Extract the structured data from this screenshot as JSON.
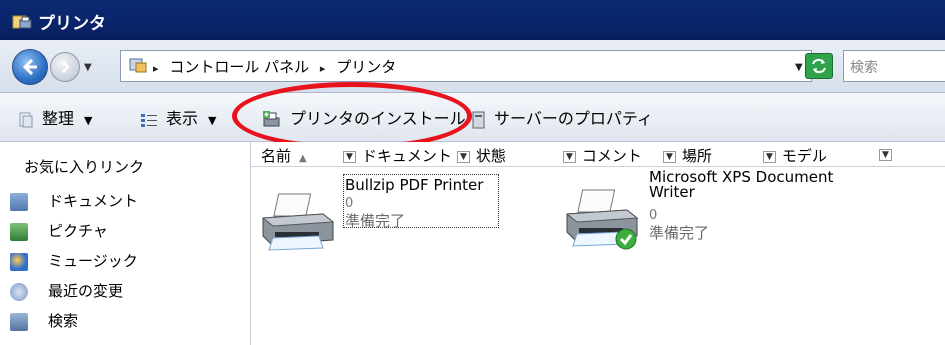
{
  "window": {
    "title": "プリンタ"
  },
  "address_bar": {
    "crumbs": [
      "コントロール パネル",
      "プリンタ"
    ],
    "search_placeholder": "検索"
  },
  "command_bar": {
    "organize": "整理",
    "view": "表示",
    "add_printer": "プリンタのインストール",
    "server_properties": "サーバーのプロパティ"
  },
  "nav_pane": {
    "favorites_title": "お気に入りリンク",
    "items": [
      {
        "label": "ドキュメント",
        "icon": "documents-icon"
      },
      {
        "label": "ピクチャ",
        "icon": "pictures-icon"
      },
      {
        "label": "ミュージック",
        "icon": "music-icon"
      },
      {
        "label": "最近の変更",
        "icon": "recent-changes-icon"
      },
      {
        "label": "検索",
        "icon": "search-folder-icon"
      }
    ]
  },
  "columns": [
    "名前",
    "ドキュメント",
    "状態",
    "コメント",
    "場所",
    "モデル"
  ],
  "printers": [
    {
      "name": "Bullzip PDF Printer",
      "documents": "0",
      "status": "準備完了",
      "is_default": false
    },
    {
      "name": "Microsoft XPS Document Writer",
      "documents": "0",
      "status": "準備完了",
      "is_default": true
    }
  ],
  "colors": {
    "titlebar": "#0a246a",
    "highlight_circle": "#e8141d",
    "default_check": "#3fae3f"
  }
}
